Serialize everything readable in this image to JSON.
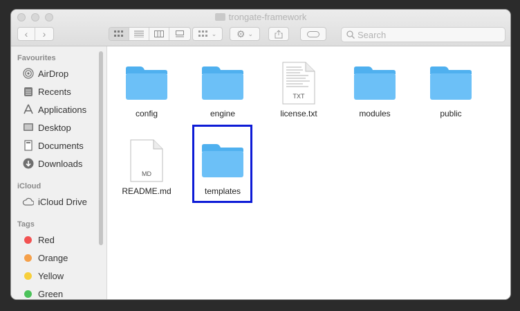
{
  "window": {
    "title": "trongate-framework"
  },
  "toolbar": {
    "search_placeholder": "Search"
  },
  "sidebar": {
    "favourites_header": "Favourites",
    "favourites": [
      {
        "label": "AirDrop",
        "icon": "airdrop-icon"
      },
      {
        "label": "Recents",
        "icon": "recents-icon"
      },
      {
        "label": "Applications",
        "icon": "applications-icon"
      },
      {
        "label": "Desktop",
        "icon": "desktop-icon"
      },
      {
        "label": "Documents",
        "icon": "documents-icon"
      },
      {
        "label": "Downloads",
        "icon": "downloads-icon"
      }
    ],
    "icloud_header": "iCloud",
    "icloud": [
      {
        "label": "iCloud Drive",
        "icon": "cloud-icon"
      }
    ],
    "tags_header": "Tags",
    "tags": [
      {
        "label": "Red",
        "color": "#f25252"
      },
      {
        "label": "Orange",
        "color": "#f5a04a"
      },
      {
        "label": "Yellow",
        "color": "#f7cf3b"
      },
      {
        "label": "Green",
        "color": "#4bc25a"
      }
    ]
  },
  "files": [
    {
      "name": "config",
      "kind": "folder"
    },
    {
      "name": "engine",
      "kind": "folder"
    },
    {
      "name": "license.txt",
      "kind": "document",
      "badge": "TXT"
    },
    {
      "name": "modules",
      "kind": "folder"
    },
    {
      "name": "public",
      "kind": "folder"
    },
    {
      "name": "README.md",
      "kind": "document",
      "badge": "MD"
    },
    {
      "name": "templates",
      "kind": "folder",
      "highlighted": true
    }
  ],
  "colors": {
    "folder": "#6cc0f7",
    "folder_tab": "#4fb0ef",
    "highlight": "#0d1bd6"
  }
}
